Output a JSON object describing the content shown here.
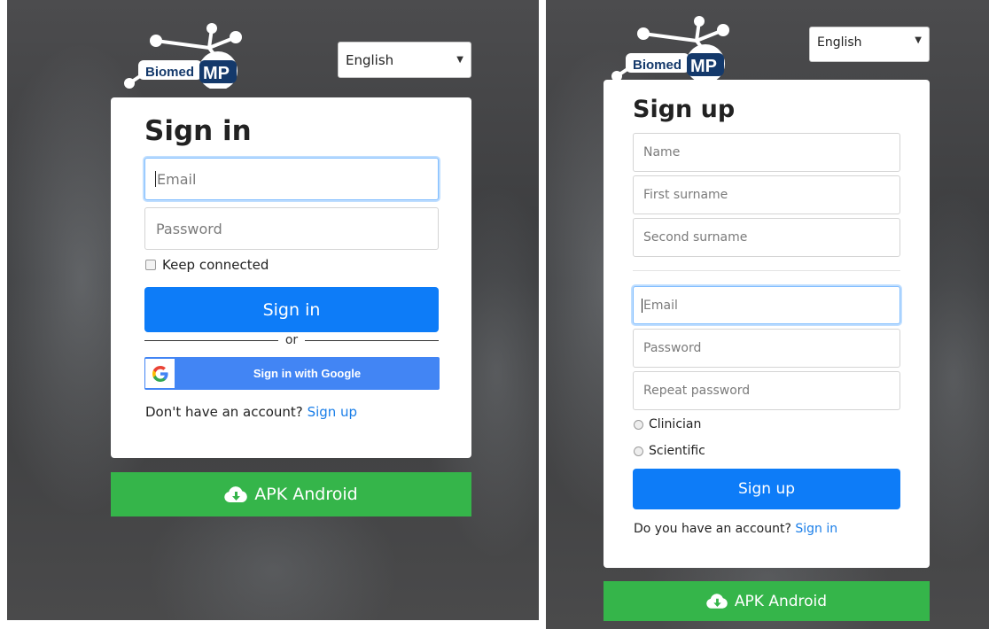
{
  "signin_view": {
    "logo": {
      "left_text": "Biomed",
      "right_text": "MP"
    },
    "language": "English",
    "title": "Sign in",
    "email_placeholder": "Email",
    "password_placeholder": "Password",
    "keep_connected": "Keep connected",
    "submit_label": "Sign in",
    "or_text": "or",
    "google_label": "Sign in with Google",
    "account_prompt": "Don't have an account?",
    "account_link": "Sign up",
    "apk_label": "APK Android",
    "apk_icon": "cloud-download-icon"
  },
  "signup_view": {
    "logo": {
      "left_text": "Biomed",
      "right_text": "MP"
    },
    "language": "English",
    "title": "Sign up",
    "name_placeholder": "Name",
    "first_surname_placeholder": "First surname",
    "second_surname_placeholder": "Second surname",
    "email_placeholder": "Email",
    "password_placeholder": "Password",
    "repeat_password_placeholder": "Repeat password",
    "roles": [
      "Clinician",
      "Scientific"
    ],
    "submit_label": "Sign up",
    "account_prompt": "Do you have an account?",
    "account_link": "Sign in",
    "apk_label": "APK Android",
    "apk_icon": "cloud-download-icon"
  },
  "colors": {
    "primary_button": "#0d7cf8",
    "google_button": "#4285f4",
    "apk_button": "#35b54a",
    "link": "#1a7ee8",
    "logo_navy": "#14396b"
  }
}
